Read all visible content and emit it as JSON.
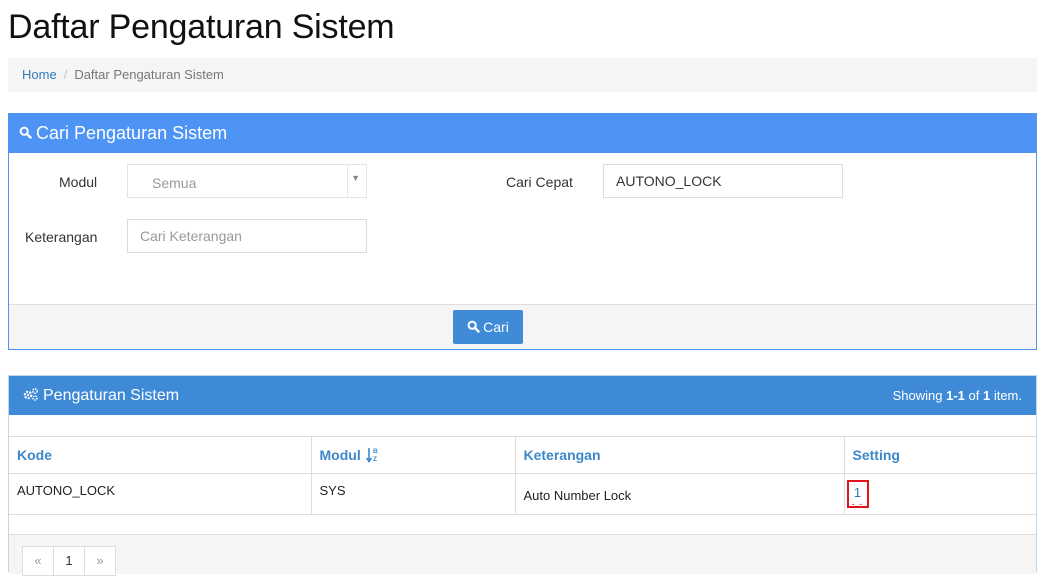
{
  "page": {
    "title": "Daftar Pengaturan Sistem"
  },
  "breadcrumb": {
    "home": "Home",
    "separator": "/",
    "current": "Daftar Pengaturan Sistem"
  },
  "search_panel": {
    "title": "Cari Pengaturan Sistem",
    "modul_label": "Modul",
    "modul_value": "Semua",
    "cari_cepat_label": "Cari Cepat",
    "cari_cepat_value": "AUTONO_LOCK",
    "keterangan_label": "Keterangan",
    "keterangan_placeholder": "Cari Keterangan",
    "button_label": "Cari"
  },
  "results_panel": {
    "title": "Pengaturan Sistem",
    "summary_prefix": "Showing ",
    "summary_range": "1-1",
    "summary_mid": " of ",
    "summary_total": "1",
    "summary_suffix": " item.",
    "columns": [
      "Kode",
      "Modul",
      "Keterangan",
      "Setting"
    ],
    "rows": [
      {
        "kode": "AUTONO_LOCK",
        "modul": "SYS",
        "keterangan": "Auto Number Lock",
        "setting": "1",
        "setting_sub": "- -"
      }
    ]
  },
  "pagination": {
    "prev": "«",
    "page": "1",
    "next": "»"
  },
  "colors": {
    "primary": "#4d94f5",
    "header": "#3e8ad6",
    "link": "#337ab7",
    "highlight": "#e0141b"
  },
  "icons": {
    "search": "search-icon",
    "settings": "gears-icon",
    "sort": "sort-alpha-icon"
  }
}
